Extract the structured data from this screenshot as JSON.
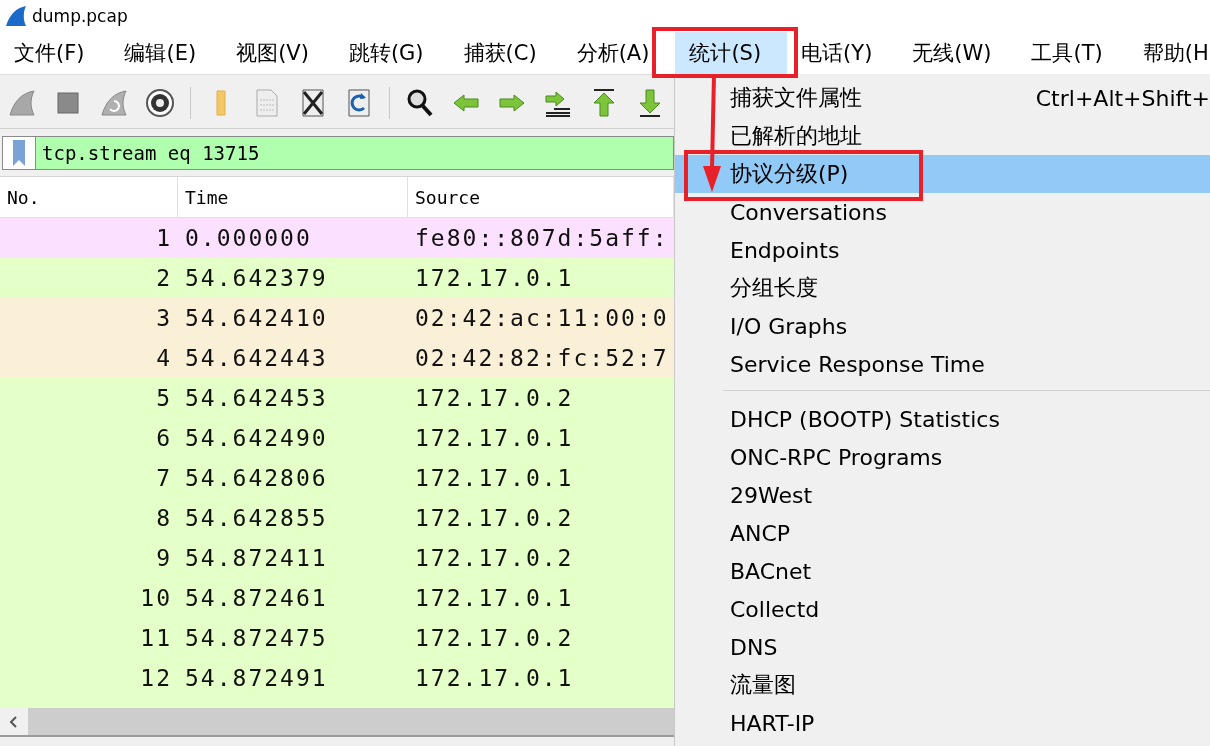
{
  "window": {
    "title": "dump.pcap"
  },
  "menubar": [
    {
      "label": "文件(F)",
      "selected": false
    },
    {
      "label": "编辑(E)",
      "selected": false
    },
    {
      "label": "视图(V)",
      "selected": false
    },
    {
      "label": "跳转(G)",
      "selected": false
    },
    {
      "label": "捕获(C)",
      "selected": false
    },
    {
      "label": "分析(A)",
      "selected": false
    },
    {
      "label": "统计(S)",
      "selected": true
    },
    {
      "label": "电话(Y)",
      "selected": false
    },
    {
      "label": "无线(W)",
      "selected": false
    },
    {
      "label": "工具(T)",
      "selected": false
    },
    {
      "label": "帮助(H",
      "selected": false
    }
  ],
  "filter": {
    "value": "tcp.stream eq 13715"
  },
  "table": {
    "columns": [
      "No.",
      "Time",
      "Source"
    ],
    "rows": [
      {
        "no": "1",
        "time": "0.000000",
        "source": "fe80::807d:5aff:",
        "color": "#fce0ff"
      },
      {
        "no": "2",
        "time": "54.642379",
        "source": "172.17.0.1",
        "color": "#e4ffc7"
      },
      {
        "no": "3",
        "time": "54.642410",
        "source": "02:42:ac:11:00:0",
        "color": "#faf0d7"
      },
      {
        "no": "4",
        "time": "54.642443",
        "source": "02:42:82:fc:52:7",
        "color": "#faf0d7"
      },
      {
        "no": "5",
        "time": "54.642453",
        "source": "172.17.0.2",
        "color": "#e4ffc7"
      },
      {
        "no": "6",
        "time": "54.642490",
        "source": "172.17.0.1",
        "color": "#e4ffc7"
      },
      {
        "no": "7",
        "time": "54.642806",
        "source": "172.17.0.1",
        "color": "#e4ffc7"
      },
      {
        "no": "8",
        "time": "54.642855",
        "source": "172.17.0.2",
        "color": "#e4ffc7"
      },
      {
        "no": "9",
        "time": "54.872411",
        "source": "172.17.0.2",
        "color": "#e4ffc7"
      },
      {
        "no": "10",
        "time": "54.872461",
        "source": "172.17.0.1",
        "color": "#e4ffc7"
      },
      {
        "no": "11",
        "time": "54.872475",
        "source": "172.17.0.2",
        "color": "#e4ffc7"
      },
      {
        "no": "12",
        "time": "54.872491",
        "source": "172.17.0.1",
        "color": "#e4ffc7"
      }
    ]
  },
  "statistics_menu": [
    {
      "kind": "item",
      "label": "捕获文件属性",
      "shortcut": "Ctrl+Alt+Shift+",
      "selected": false
    },
    {
      "kind": "item",
      "label": "已解析的地址",
      "selected": false
    },
    {
      "kind": "item",
      "label": "协议分级(P)",
      "selected": true
    },
    {
      "kind": "item",
      "label": "Conversations",
      "selected": false
    },
    {
      "kind": "item",
      "label": "Endpoints",
      "selected": false
    },
    {
      "kind": "item",
      "label": "分组长度",
      "selected": false
    },
    {
      "kind": "item",
      "label": "I/O Graphs",
      "selected": false
    },
    {
      "kind": "item",
      "label": "Service Response Time",
      "selected": false
    },
    {
      "kind": "separator"
    },
    {
      "kind": "item",
      "label": "DHCP (BOOTP) Statistics",
      "selected": false
    },
    {
      "kind": "item",
      "label": "ONC-RPC Programs",
      "selected": false
    },
    {
      "kind": "item",
      "label": "29West",
      "selected": false
    },
    {
      "kind": "item",
      "label": "ANCP",
      "selected": false
    },
    {
      "kind": "item",
      "label": "BACnet",
      "selected": false
    },
    {
      "kind": "item",
      "label": "Collectd",
      "selected": false
    },
    {
      "kind": "item",
      "label": "DNS",
      "selected": false
    },
    {
      "kind": "item",
      "label": "流量图",
      "selected": false
    },
    {
      "kind": "item",
      "label": "HART-IP",
      "selected": false
    }
  ]
}
